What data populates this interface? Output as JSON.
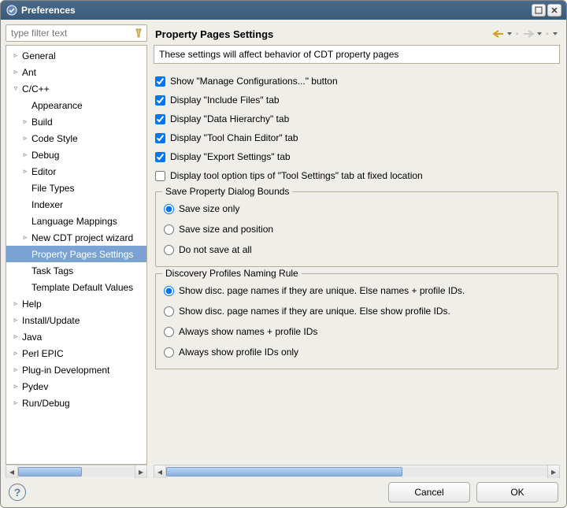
{
  "window": {
    "title": "Preferences"
  },
  "filter": {
    "placeholder": "type filter text"
  },
  "tree": [
    {
      "label": "General",
      "expandable": true,
      "expanded": false,
      "indent": 0
    },
    {
      "label": "Ant",
      "expandable": true,
      "expanded": false,
      "indent": 0
    },
    {
      "label": "C/C++",
      "expandable": true,
      "expanded": true,
      "indent": 0
    },
    {
      "label": "Appearance",
      "expandable": false,
      "indent": 1
    },
    {
      "label": "Build",
      "expandable": true,
      "expanded": false,
      "indent": 1
    },
    {
      "label": "Code Style",
      "expandable": true,
      "expanded": false,
      "indent": 1
    },
    {
      "label": "Debug",
      "expandable": true,
      "expanded": false,
      "indent": 1
    },
    {
      "label": "Editor",
      "expandable": true,
      "expanded": false,
      "indent": 1
    },
    {
      "label": "File Types",
      "expandable": false,
      "indent": 1
    },
    {
      "label": "Indexer",
      "expandable": false,
      "indent": 1
    },
    {
      "label": "Language Mappings",
      "expandable": false,
      "indent": 1
    },
    {
      "label": "New CDT project wizard",
      "expandable": true,
      "expanded": false,
      "indent": 1
    },
    {
      "label": "Property Pages Settings",
      "expandable": false,
      "indent": 1,
      "selected": true
    },
    {
      "label": "Task Tags",
      "expandable": false,
      "indent": 1
    },
    {
      "label": "Template Default Values",
      "expandable": false,
      "indent": 1
    },
    {
      "label": "Help",
      "expandable": true,
      "expanded": false,
      "indent": 0
    },
    {
      "label": "Install/Update",
      "expandable": true,
      "expanded": false,
      "indent": 0
    },
    {
      "label": "Java",
      "expandable": true,
      "expanded": false,
      "indent": 0
    },
    {
      "label": "Perl EPIC",
      "expandable": true,
      "expanded": false,
      "indent": 0
    },
    {
      "label": "Plug-in Development",
      "expandable": true,
      "expanded": false,
      "indent": 0
    },
    {
      "label": "Pydev",
      "expandable": true,
      "expanded": false,
      "indent": 0
    },
    {
      "label": "Run/Debug",
      "expandable": true,
      "expanded": false,
      "indent": 0
    }
  ],
  "page": {
    "title": "Property Pages Settings",
    "description": "These settings will affect behavior of CDT property pages"
  },
  "checkboxes": [
    {
      "label": "Show \"Manage Configurations...\" button",
      "checked": true
    },
    {
      "label": "Display \"Include Files\" tab",
      "checked": true
    },
    {
      "label": "Display \"Data Hierarchy\" tab",
      "checked": true
    },
    {
      "label": "Display \"Tool Chain Editor\" tab",
      "checked": true
    },
    {
      "label": "Display \"Export Settings\" tab",
      "checked": true
    },
    {
      "label": "Display tool option tips of \"Tool Settings\" tab at fixed location",
      "checked": false
    }
  ],
  "group1": {
    "legend": "Save Property Dialog Bounds",
    "options": [
      {
        "label": "Save size only",
        "checked": true
      },
      {
        "label": "Save size and position",
        "checked": false
      },
      {
        "label": "Do not save at all",
        "checked": false
      }
    ]
  },
  "group2": {
    "legend": "Discovery Profiles Naming Rule",
    "options": [
      {
        "label": "Show disc. page names if they are unique. Else names + profile IDs.",
        "checked": true
      },
      {
        "label": "Show disc. page names if they are unique. Else show profile IDs.",
        "checked": false
      },
      {
        "label": "Always show names + profile IDs",
        "checked": false
      },
      {
        "label": "Always show profile IDs only",
        "checked": false
      }
    ]
  },
  "buttons": {
    "cancel": "Cancel",
    "ok": "OK"
  }
}
